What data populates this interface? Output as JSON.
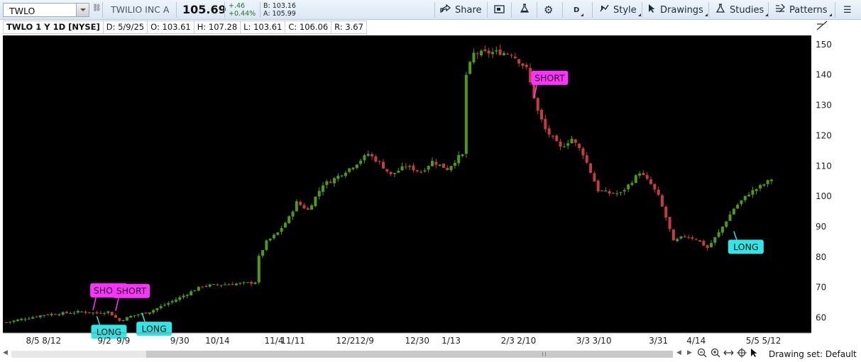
{
  "toolbar": {
    "symbol": "TWLO",
    "company": "TWILIO INC A",
    "last_price": "105.69",
    "change": "+.46",
    "change_pct": "+0.44%",
    "bid": "B: 103.16",
    "ask": "A: 105.99",
    "share_label": "Share",
    "period_label": "D",
    "style_label": "Style",
    "drawings_label": "Drawings",
    "studies_label": "Studies",
    "patterns_label": "Patterns",
    "icons": [
      "dropdown-icon",
      "link-icon",
      "share-icon",
      "screenshot-icon",
      "flask-icon",
      "gear-icon",
      "cursor-icon",
      "studies-flask-icon",
      "patterns-icon",
      "menu-icon"
    ]
  },
  "infobar": {
    "title": "TWLO 1 Y 1D [NYSE]",
    "date": "D: 5/9/25",
    "open": "O: 103.61",
    "high": "H: 107.28",
    "low": "L: 103.61",
    "close": "C: 106.06",
    "range": "R: 3.67"
  },
  "footer": {
    "drawing_set": "Drawing set: Default"
  },
  "colors": {
    "up": "#4c9a1c",
    "down": "#c43c3c",
    "background": "#000000",
    "short_label": "#ff33ff",
    "long_label": "#33e5e5"
  },
  "chart_data": {
    "type": "candlestick",
    "symbol": "TWLO",
    "aggregation": "1D",
    "ylim": [
      55,
      153
    ],
    "yticks": [
      60,
      70,
      80,
      90,
      100,
      110,
      120,
      130,
      140,
      150
    ],
    "xticks": [
      {
        "label": "8/5",
        "index": 7
      },
      {
        "label": "8/12",
        "index": 12
      },
      {
        "label": "9/2",
        "index": 26
      },
      {
        "label": "9/9",
        "index": 31
      },
      {
        "label": "9/30",
        "index": 46
      },
      {
        "label": "10/14",
        "index": 56
      },
      {
        "label": "11/4",
        "index": 71
      },
      {
        "label": "11/11",
        "index": 76
      },
      {
        "label": "12/2",
        "index": 90
      },
      {
        "label": "12/9",
        "index": 95
      },
      {
        "label": "12/30",
        "index": 109
      },
      {
        "label": "1/13",
        "index": 118
      },
      {
        "label": "2/3",
        "index": 133
      },
      {
        "label": "2/10",
        "index": 138
      },
      {
        "label": "3/3",
        "index": 153
      },
      {
        "label": "3/10",
        "index": 158
      },
      {
        "label": "3/31",
        "index": 173
      },
      {
        "label": "4/14",
        "index": 183
      },
      {
        "label": "5/5",
        "index": 198
      },
      {
        "label": "5/12",
        "index": 203
      }
    ],
    "keypoints": [
      [
        0,
        58.5
      ],
      [
        10,
        61
      ],
      [
        20,
        62
      ],
      [
        24,
        61.5
      ],
      [
        27,
        62
      ],
      [
        30,
        59
      ],
      [
        33,
        60.5
      ],
      [
        38,
        62
      ],
      [
        45,
        66
      ],
      [
        52,
        70.5
      ],
      [
        58,
        71
      ],
      [
        65,
        71.5
      ],
      [
        66,
        71.8
      ],
      [
        67,
        80
      ],
      [
        69,
        85
      ],
      [
        72,
        88
      ],
      [
        75,
        93
      ],
      [
        77,
        98
      ],
      [
        80,
        95.5
      ],
      [
        84,
        104
      ],
      [
        86,
        105
      ],
      [
        92,
        110
      ],
      [
        96,
        114
      ],
      [
        99,
        111
      ],
      [
        102,
        107
      ],
      [
        106,
        110
      ],
      [
        110,
        108
      ],
      [
        113,
        111.5
      ],
      [
        117,
        109
      ],
      [
        120,
        113
      ],
      [
        121,
        113.5
      ],
      [
        122,
        140
      ],
      [
        124,
        147
      ],
      [
        130,
        147.5
      ],
      [
        134,
        147
      ],
      [
        138,
        142
      ],
      [
        141,
        128
      ],
      [
        143,
        122
      ],
      [
        147,
        116
      ],
      [
        150,
        119
      ],
      [
        153,
        114
      ],
      [
        157,
        102
      ],
      [
        160,
        101
      ],
      [
        163,
        101
      ],
      [
        166,
        105
      ],
      [
        168,
        108
      ],
      [
        171,
        104
      ],
      [
        173,
        100
      ],
      [
        175,
        93
      ],
      [
        177,
        85
      ],
      [
        180,
        87
      ],
      [
        183,
        86
      ],
      [
        186,
        83
      ],
      [
        189,
        88
      ],
      [
        193,
        96
      ],
      [
        197,
        101
      ],
      [
        201,
        104
      ],
      [
        203,
        105.7
      ]
    ],
    "last_bar": {
      "date": "5/9/25",
      "open": 103.61,
      "high": 107.28,
      "low": 103.61,
      "close": 106.06
    },
    "signals": [
      {
        "label": "SHORT",
        "index": 23,
        "price": 62.5
      },
      {
        "label": "SHORT",
        "index": 29,
        "price": 62.3
      },
      {
        "label": "LONG",
        "index": 24,
        "price": 60.5
      },
      {
        "label": "LONG",
        "index": 36,
        "price": 61.5
      },
      {
        "label": "SHORT",
        "index": 140,
        "price": 132.5
      },
      {
        "label": "LONG",
        "index": 193,
        "price": 88.5
      }
    ]
  }
}
